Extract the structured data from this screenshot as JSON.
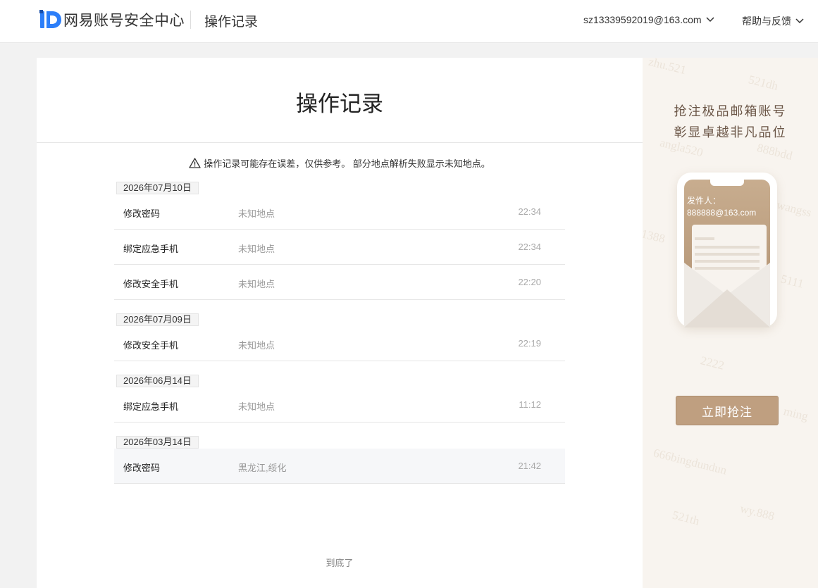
{
  "header": {
    "logo_text": "网易账号安全中心",
    "page_title": "操作记录",
    "account": "sz13339592019@163.com",
    "help": "帮助与反馈"
  },
  "main": {
    "title": "操作记录",
    "notice": "操作记录可能存在误差，仅供参考。 部分地点解析失败显示未知地点。",
    "groups": [
      {
        "date": "2026年07月10日",
        "rows": [
          {
            "op": "修改密码",
            "loc": "未知地点",
            "time": "22:34"
          },
          {
            "op": "绑定应急手机",
            "loc": "未知地点",
            "time": "22:34"
          },
          {
            "op": "修改安全手机",
            "loc": "未知地点",
            "time": "22:20"
          }
        ]
      },
      {
        "date": "2026年07月09日",
        "rows": [
          {
            "op": "修改安全手机",
            "loc": "未知地点",
            "time": "22:19"
          }
        ]
      },
      {
        "date": "2026年06月14日",
        "rows": [
          {
            "op": "绑定应急手机",
            "loc": "未知地点",
            "time": "11:12"
          }
        ]
      },
      {
        "date": "2026年03月14日",
        "rows": [
          {
            "op": "修改密码",
            "loc": "黑龙江,绥化",
            "time": "21:42"
          }
        ]
      }
    ],
    "bottom_text": "到底了"
  },
  "ad": {
    "line1": "抢注极品邮箱账号",
    "line2": "彰显卓越非凡品位",
    "sender_label": "发件人：",
    "sender_email": "888888@163.com",
    "button": "立即抢注",
    "watermarks": [
      "521dh",
      "888bdd",
      "angla520",
      "wangss",
      "1388",
      "5111",
      "2222",
      "666bingdundun",
      "ming",
      "521th",
      "wy.888",
      "zhu.521"
    ]
  },
  "colors": {
    "brand_blue": "#2d7ff9",
    "ad_gold": "#bf9f80"
  }
}
